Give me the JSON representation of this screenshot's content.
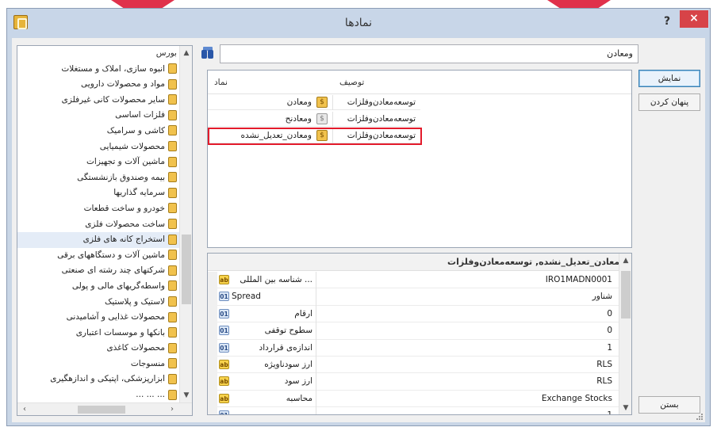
{
  "window": {
    "title": "نمادها",
    "help_label": "?",
    "close_label": "×"
  },
  "tree": {
    "items": [
      {
        "label": "بورس",
        "root": true
      },
      {
        "label": "انبوه سازی، املاک و مستغلات"
      },
      {
        "label": "مواد و محصولات دارویی"
      },
      {
        "label": "سایر محصولات کانی غیرفلزی"
      },
      {
        "label": "فلزات اساسی"
      },
      {
        "label": "کاشی و سرامیک"
      },
      {
        "label": "محصولات شیمیایی"
      },
      {
        "label": "ماشین آلات و تجهیزات"
      },
      {
        "label": "بیمه وصندوق بازنشستگی"
      },
      {
        "label": "سرمایه گذاریها"
      },
      {
        "label": "خودرو و ساخت قطعات"
      },
      {
        "label": "ساخت محصولات فلزی"
      },
      {
        "label": "استخراج کانه های فلزی",
        "selected": true
      },
      {
        "label": "ماشین آلات و دستگاههای برقی"
      },
      {
        "label": "شرکتهای چند رشته ای صنعتی"
      },
      {
        "label": "واسطه‌گریهای مالی و پولی"
      },
      {
        "label": "لاستیک و پلاستیک"
      },
      {
        "label": "محصولات غذایی و آشامیدنی"
      },
      {
        "label": "بانکها و موسسات اعتباری"
      },
      {
        "label": "محصولات کاغذی"
      },
      {
        "label": "منسوجات"
      },
      {
        "label": "ابزارپزشکی، اپتیکی و اندازهگیری"
      },
      {
        "label": "... ... ..."
      }
    ]
  },
  "search": {
    "value": "ومعادن"
  },
  "symbols": {
    "headers": {
      "symbol": "نماد",
      "description": "توصیف"
    },
    "rows": [
      {
        "symbol": "ومعادن",
        "description": "توسعه‌معادن‌وفلزات",
        "icon": "gold"
      },
      {
        "symbol": "ومعادنح",
        "description": "توسعه‌معادن‌وفلزات",
        "icon": "grey"
      },
      {
        "symbol": "ومعادن_تعدیل_نشده",
        "description": "توسعه‌معادن‌وفلزات",
        "icon": "gold",
        "highlighted": true
      }
    ]
  },
  "properties": {
    "title": "ومعادن_تعدیل_نشده, توسعه‌معادن‌وفلزات",
    "rows": [
      {
        "icon": "ab",
        "name": "... شناسه بین المللی",
        "value": "IRO1MADN0001"
      },
      {
        "icon": "01",
        "name": "Spread",
        "value": "شناور",
        "ltr": true
      },
      {
        "icon": "01",
        "name": "ارقام",
        "value": "0"
      },
      {
        "icon": "01",
        "name": "سطوح توقفی",
        "value": "0"
      },
      {
        "icon": "01",
        "name": "اندازه‌ی قرارداد",
        "value": "1"
      },
      {
        "icon": "ab",
        "name": "ارز سودناویژه",
        "value": "RLS"
      },
      {
        "icon": "ab",
        "name": "ارز سود",
        "value": "RLS"
      },
      {
        "icon": "ab",
        "name": "محاسبه",
        "value": "Exchange Stocks"
      },
      {
        "icon": "01",
        "name": "... ... ...",
        "value": "1"
      }
    ]
  },
  "buttons": {
    "show": "نمایش",
    "hide": "پنهان کردن",
    "close": "بستن"
  },
  "icons": {
    "app": "folder-gold-icon",
    "search": "binoculars-icon"
  },
  "colors": {
    "highlight_border": "#e31b2b",
    "close_button": "#d74348",
    "title_bar": "#c8d6e8"
  }
}
